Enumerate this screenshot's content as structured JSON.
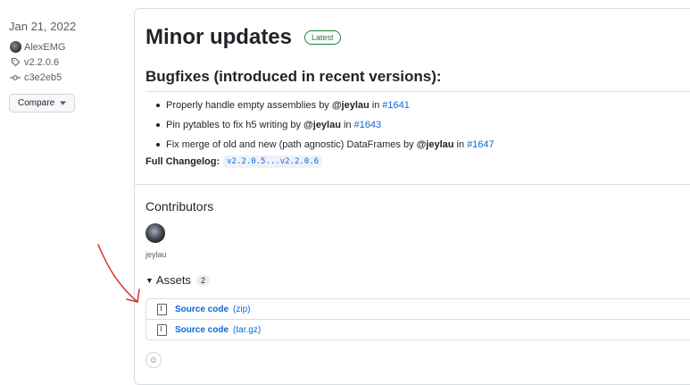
{
  "meta": {
    "date": "Jan 21, 2022",
    "author": "AlexEMG",
    "tag": "v2.2.0.6",
    "commit": "c3e2eb5",
    "compare_label": "Compare"
  },
  "release": {
    "title": "Minor updates",
    "badge": "Latest",
    "section_heading": "Bugfixes (introduced in recent versions):",
    "bugfixes": [
      {
        "text": "Properly handle empty assemblies by",
        "user": "@jeylau",
        "mid": "in",
        "link": "#1641"
      },
      {
        "text": "Pin pytables to fix h5 writing by",
        "user": "@jeylau",
        "mid": "in",
        "link": "#1643"
      },
      {
        "text": "Fix merge of old and new (path agnostic) DataFrames by",
        "user": "@jeylau",
        "mid": "in",
        "link": "#1647"
      }
    ],
    "changelog_label": "Full Changelog:",
    "changelog_link": "v2.2.0.5...v2.2.0.6"
  },
  "contributors": {
    "heading": "Contributors",
    "names": [
      "jeylau"
    ]
  },
  "assets": {
    "heading": "Assets",
    "count": "2",
    "items": [
      {
        "name": "Source code",
        "ext": "(zip)"
      },
      {
        "name": "Source code",
        "ext": "(tar.gz)"
      }
    ]
  },
  "colors": {
    "link": "#0969da",
    "latest_badge": "#1a7f37",
    "annotation": "#d9302c"
  },
  "icons": {
    "tag": "tag-icon",
    "commit": "commit-icon",
    "caret": "chevron-down-icon",
    "zip": "file-zip-icon",
    "emoji": "smiley-icon"
  }
}
